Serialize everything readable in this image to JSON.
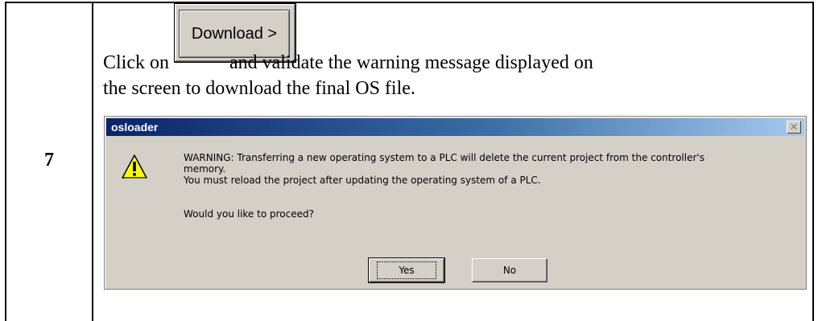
{
  "step": {
    "number": "7"
  },
  "instruction": {
    "click_on": "Click on",
    "after_button": "and validate the warning message displayed on",
    "line2": "the screen to download the final OS file.",
    "inline_button_label": "Download >"
  },
  "dialog": {
    "title": "osloader",
    "close_glyph": "✕",
    "icon": "warning-icon",
    "message_line1": "WARNING: Transferring a new operating system to a PLC will delete the current project from the controller's",
    "message_line2": "memory.",
    "message_line3": "You must reload  the project after updating the operating system of a PLC.",
    "question": "Would you like to proceed?",
    "yes_label": "Yes",
    "no_label": "No"
  }
}
